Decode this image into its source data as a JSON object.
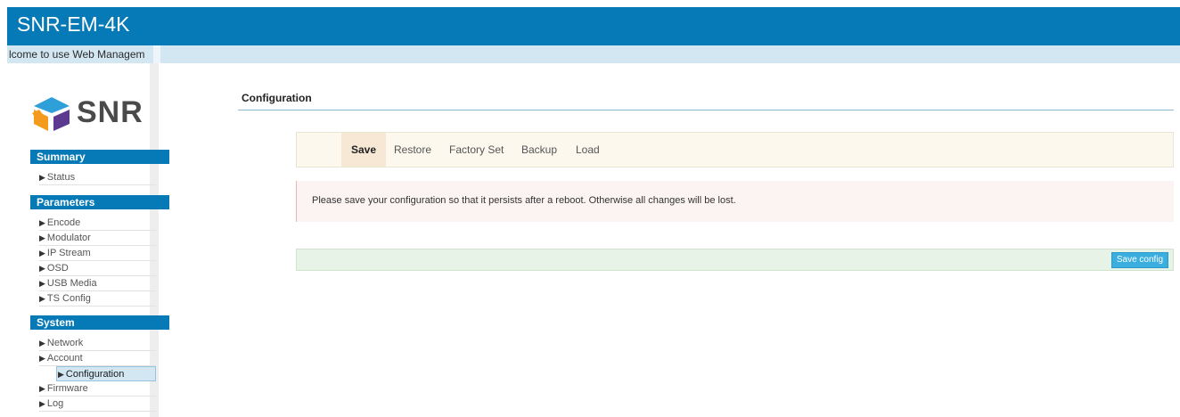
{
  "header": {
    "title": "SNR-EM-4K",
    "welcome": "lcome to use Web Managem"
  },
  "logo": {
    "text": "SNR"
  },
  "sidebar": {
    "sections": [
      {
        "title": "Summary",
        "items": [
          "Status"
        ]
      },
      {
        "title": "Parameters",
        "items": [
          "Encode",
          "Modulator",
          "IP Stream",
          "OSD",
          "USB Media",
          "TS Config"
        ]
      },
      {
        "title": "System",
        "items": [
          "Network",
          "Account",
          "Configuration",
          "Firmware",
          "Log"
        ]
      }
    ],
    "active_item": "Configuration"
  },
  "main": {
    "title": "Configuration",
    "tabs": [
      "Save",
      "Restore",
      "Factory Set",
      "Backup",
      "Load"
    ],
    "active_tab": "Save",
    "alert": "Please save your configuration so that it persists after a reboot. Otherwise all changes will be lost.",
    "save_button": "Save config"
  },
  "colors": {
    "brand": "#0679b7",
    "accent_button": "#3aaedf",
    "alert_bg": "#fcf3f3",
    "toolbar_bg": "#fcf8ee",
    "footer_bg": "#e8f3e8"
  },
  "icons": {
    "logo_mark": "snr-cube-logo-icon",
    "nav_arrow": "triangle-right-icon"
  }
}
